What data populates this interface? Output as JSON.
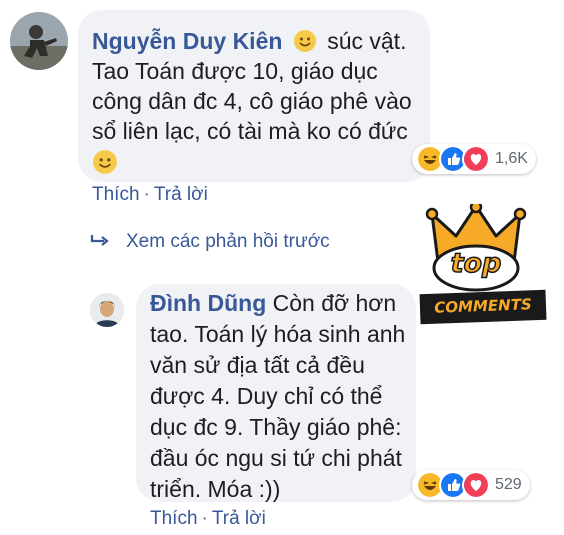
{
  "comment1": {
    "author": "Nguyễn Duy Kiên",
    "line1_after_emoji": "súc vật.",
    "line2": "Tao Toán được 10, giáo dục",
    "line3": "công dân đc 4, cô giáo phê vào",
    "line4": "sổ liên lạc, có tài mà ko có đức",
    "emoji_icon": "smiley-emoji-icon",
    "reaction_count": "1,6K",
    "actions": {
      "like": "Thích",
      "separator": "·",
      "reply": "Trả lời"
    }
  },
  "view_previous_replies": "Xem các phản hồi trước",
  "comment2": {
    "author": "Đình Dũng",
    "line1_after_name": "Còn đỡ hơn",
    "line2": "tao. Toán lý hóa sinh anh",
    "line3": "văn sử địa tất cả đều",
    "line4": "được 4. Duy chỉ có thể",
    "line5": "dục đc 9. Thầy giáo phê:",
    "line6": "đầu óc ngu si tứ chi phát",
    "line7": "triển. Móa :))",
    "reaction_count": "529",
    "actions": {
      "like": "Thích",
      "separator": "·",
      "reply": "Trả lời"
    }
  },
  "badge": {
    "top": "top",
    "comments": "COMMENTS"
  },
  "colors": {
    "link": "#385898",
    "bubble": "#f0f2f5",
    "haha": "#f7b928",
    "like": "#1877f2",
    "love": "#f33e58",
    "crown": "#f7a928"
  }
}
